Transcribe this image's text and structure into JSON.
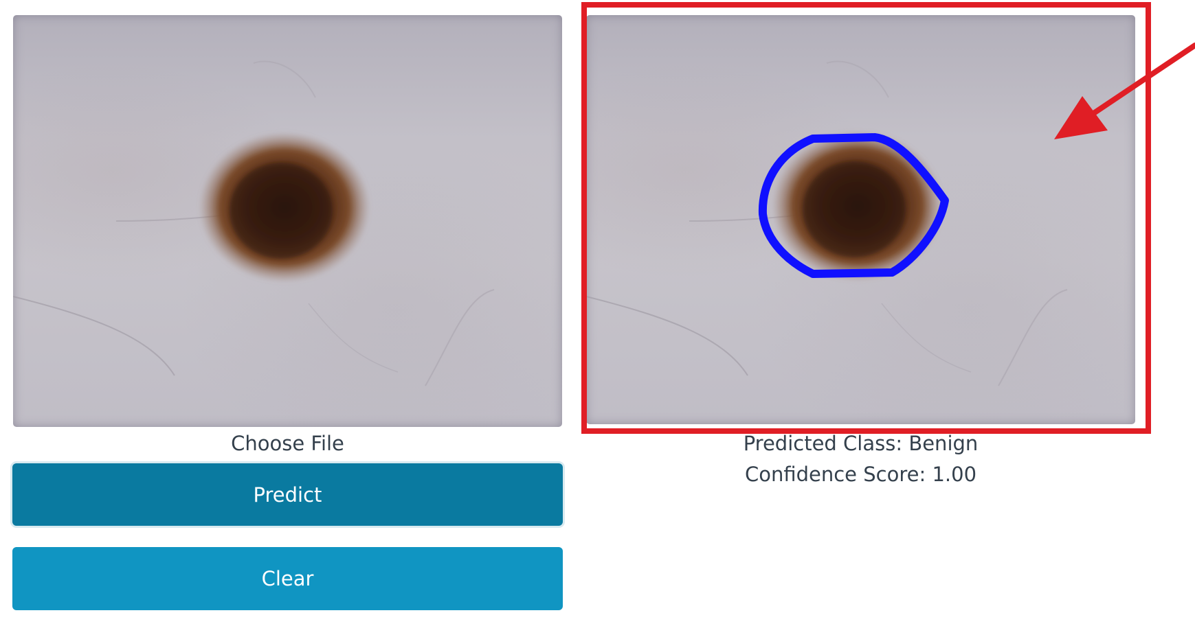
{
  "upload": {
    "choose_file_label": "Choose File",
    "uploaded_image": "dermoscopy-lesion-image"
  },
  "actions": {
    "predict_label": "Predict",
    "clear_label": "Clear"
  },
  "result": {
    "segmented_image": "dermoscopy-lesion-image-with-segmentation-outline",
    "predicted_class_text": "Predicted Class: Benign",
    "confidence_text": "Confidence Score: 1.00"
  },
  "colors": {
    "predict_button": "#0a7aa0",
    "clear_button": "#1095c2",
    "highlight_frame": "#e01e25",
    "segmentation_outline": "#1010ff"
  }
}
